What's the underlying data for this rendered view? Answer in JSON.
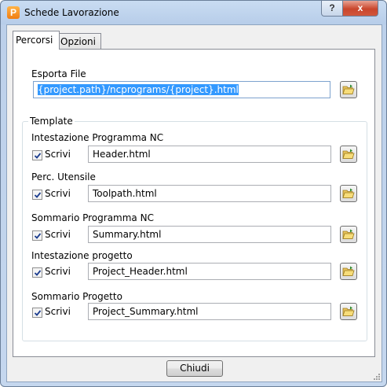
{
  "window": {
    "title": "Schede Lavorazione",
    "help_label": "?",
    "close_label": "x",
    "app_icon_label": "P"
  },
  "tabs": [
    {
      "label": "Percorsi",
      "active": true
    },
    {
      "label": "Opzioni",
      "active": false
    }
  ],
  "export": {
    "label": "Esporta File",
    "value": "{project.path}/ncprograms/{project}.html"
  },
  "template": {
    "title": "Template",
    "rows": [
      {
        "label": "Intestazione Programma NC",
        "checkbox_label": "Scrivi",
        "checked": true,
        "value": "Header.html"
      },
      {
        "label": "Perc. Utensile",
        "checkbox_label": "Scrivi",
        "checked": true,
        "value": "Toolpath.html"
      },
      {
        "label": "Sommario Programma NC",
        "checkbox_label": "Scrivi",
        "checked": true,
        "value": "Summary.html"
      },
      {
        "label": "Intestazione progetto",
        "checkbox_label": "Scrivi",
        "checked": true,
        "value": "Project_Header.html"
      },
      {
        "label": "Sommario Progetto",
        "checkbox_label": "Scrivi",
        "checked": true,
        "value": "Project_Summary.html"
      }
    ]
  },
  "footer": {
    "close_label": "Chiudi"
  },
  "icons": {
    "browse": "folder-open-icon",
    "check": "check-icon"
  }
}
